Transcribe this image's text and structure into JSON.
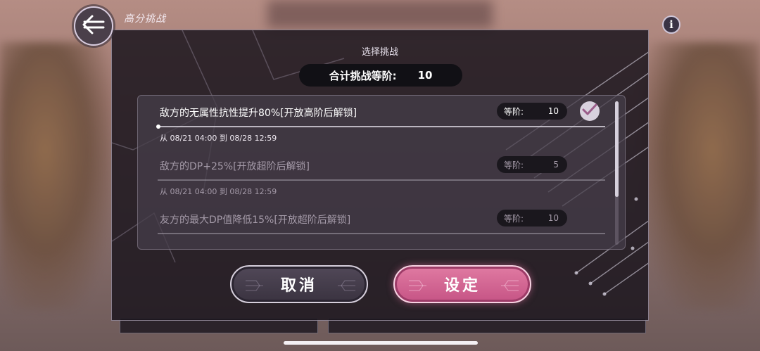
{
  "header": {
    "title": "高分挑战"
  },
  "dialog": {
    "title": "选择挑战",
    "total_label": "合计挑战等阶:",
    "total_value": "10"
  },
  "challenges": [
    {
      "name": "敌方的无属性抗性提升80%[开放高阶后解锁]",
      "rank_label": "等阶:",
      "rank_value": "10",
      "period": "从 08/21 04:00 到 08/28 12:59",
      "selected": true
    },
    {
      "name": "敌方的DP+25%[开放超阶后解锁]",
      "rank_label": "等阶:",
      "rank_value": "5",
      "period": "从 08/21 04:00 到 08/28 12:59",
      "selected": false
    },
    {
      "name": "友方的最大DP值降低15%[开放超阶后解锁]",
      "rank_label": "等阶:",
      "rank_value": "10",
      "period": "",
      "selected": false
    }
  ],
  "buttons": {
    "cancel": "取消",
    "confirm": "设定"
  },
  "icons": {
    "back": "back-arrow-icon",
    "info": "info-icon",
    "check": "checkmark-icon"
  },
  "colors": {
    "confirm": "#d7669a",
    "panel": "#1c161e"
  }
}
